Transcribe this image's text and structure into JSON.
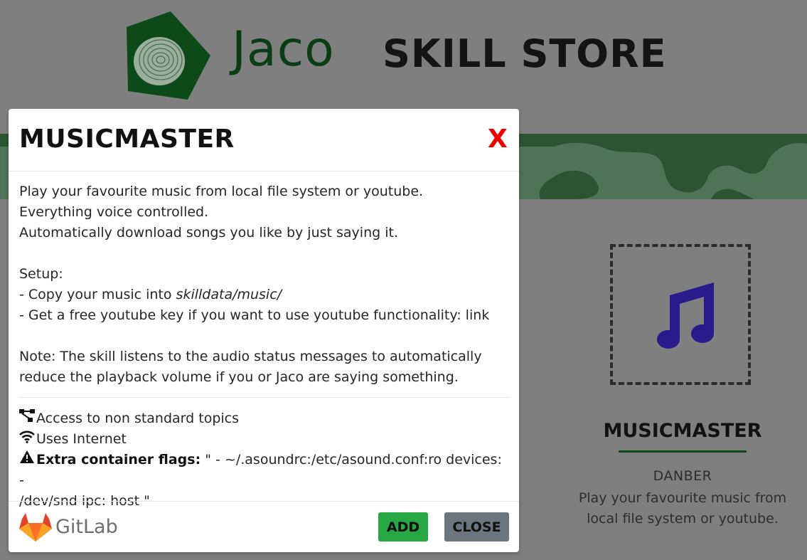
{
  "header": {
    "logo_text": "Jaco",
    "store_title": "SKILL STORE"
  },
  "skill_card": {
    "name": "MUSICMASTER",
    "author": "DANBER",
    "description_line1": "Play your favourite music from",
    "description_line2": "local file system or youtube.",
    "icon": "music-note-icon",
    "icon_color": "#2a1a8c"
  },
  "modal": {
    "title": "MUSICMASTER",
    "close_x": "X",
    "description": {
      "line1": "Play your favourite music from local file system or youtube.",
      "line2": "Everything voice controlled.",
      "line3": "Automatically download songs you like by just saying it.",
      "setup_label": "Setup:",
      "setup_item1_prefix": "- Copy your music into ",
      "setup_item1_path": "skilldata/music/",
      "setup_item2": "- Get a free youtube key if you want to use youtube functionality: link",
      "note_line1": "Note: The skill listens to the audio status messages to automatically",
      "note_line2": "reduce the playback volume if you or Jaco are saying something."
    },
    "permissions": {
      "topics": "Access to non standard topics",
      "internet": "Uses Internet",
      "flags_label": "Extra container flags:",
      "flags_value_line1": " \" - ~/.asoundrc:/etc/asound.conf:ro devices: -",
      "flags_value_line2": "/dev/snd ipc: host \""
    },
    "footer": {
      "gitlab_label": "GitLab",
      "add_label": "ADD",
      "close_label": "CLOSE"
    }
  },
  "colors": {
    "accent_green": "#28a745",
    "close_gray": "#6c757d",
    "close_x_red": "#ee0000",
    "brand_dark_green": "#0b3d14"
  }
}
